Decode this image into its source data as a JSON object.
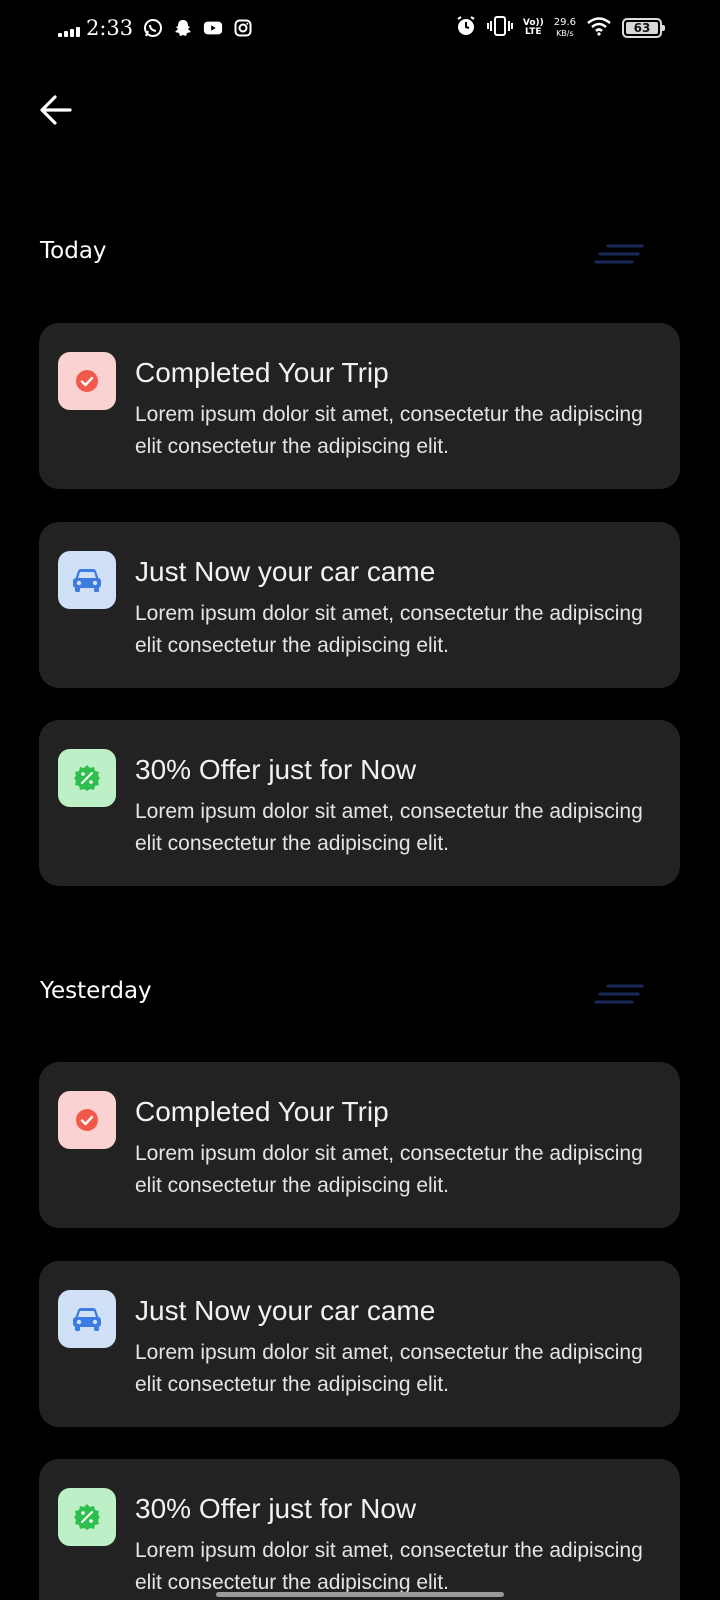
{
  "status_bar": {
    "time": "2:33",
    "volte": "Vo))",
    "lte": "LTE",
    "speed_value": "29.6",
    "speed_unit": "KB/s",
    "battery": "63",
    "app_icons": [
      "whatsapp-icon",
      "snapchat-icon",
      "youtube-icon",
      "instagram-icon"
    ],
    "right_icons": [
      "alarm-icon",
      "vibrate-icon",
      "wifi-icon"
    ]
  },
  "header": {
    "back_icon": "arrow-left-icon"
  },
  "sections": [
    {
      "label": "Today",
      "items": [
        {
          "title": "Completed Your Trip",
          "body": "Lorem ipsum dolor sit amet, consectetur the adipiscing elit consectetur the adipiscing elit.",
          "icon": "check-circle-icon",
          "icon_bg": "#fbd2d2",
          "icon_color": "#f2594b"
        },
        {
          "title": "Just Now your car came",
          "body": "Lorem ipsum dolor sit amet, consectetur the adipiscing elit consectetur the adipiscing elit.",
          "icon": "car-icon",
          "icon_bg": "#cfe0f7",
          "icon_color": "#3d7be0"
        },
        {
          "title": "30% Offer just for Now",
          "body": "Lorem ipsum dolor sit amet, consectetur the adipiscing elit consectetur the adipiscing elit.",
          "icon": "discount-badge-icon",
          "icon_bg": "#bdf0c6",
          "icon_color": "#2fbf4f"
        }
      ]
    },
    {
      "label": "Yesterday",
      "items": [
        {
          "title": "Completed Your Trip",
          "body": "Lorem ipsum dolor sit amet, consectetur the adipiscing elit consectetur the adipiscing elit.",
          "icon": "check-circle-icon",
          "icon_bg": "#fbd2d2",
          "icon_color": "#f2594b"
        },
        {
          "title": "Just Now your car came",
          "body": "Lorem ipsum dolor sit amet, consectetur the adipiscing elit consectetur the adipiscing elit.",
          "icon": "car-icon",
          "icon_bg": "#cfe0f7",
          "icon_color": "#3d7be0"
        },
        {
          "title": "30% Offer just for Now",
          "body": "Lorem ipsum dolor sit amet, consectetur the adipiscing elit consectetur the adipiscing elit.",
          "icon": "discount-badge-icon",
          "icon_bg": "#bdf0c6",
          "icon_color": "#2fbf4f"
        }
      ]
    }
  ],
  "colors": {
    "background": "#000000",
    "card": "#222222",
    "text": "#f2f2f2",
    "filter_lines": "#1a2a5a"
  }
}
